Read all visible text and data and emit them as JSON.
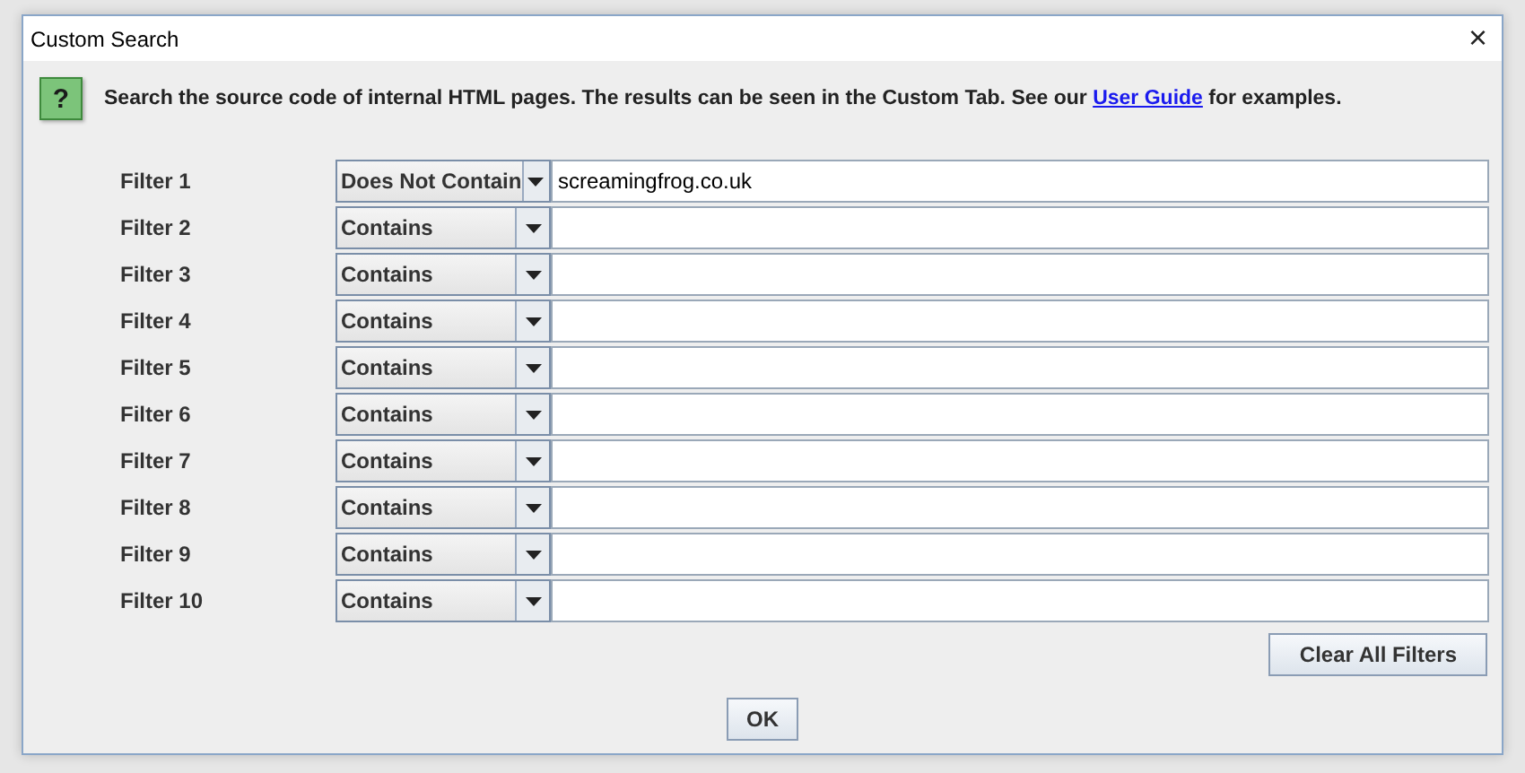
{
  "window": {
    "title": "Custom Search",
    "close": "×"
  },
  "help_icon": "?",
  "intro": {
    "text": "Search the source code of internal HTML pages. The results can be seen in the Custom Tab. See our ",
    "link": "User Guide",
    "text_after": " for examples."
  },
  "filters": [
    {
      "label": "Filter 1",
      "mode": "Does Not Contain",
      "value": "screamingfrog.co.uk"
    },
    {
      "label": "Filter 2",
      "mode": "Contains"
    },
    {
      "label": "Filter 3",
      "mode": "Contains"
    },
    {
      "label": "Filter 4",
      "mode": "Contains"
    },
    {
      "label": "Filter 5",
      "mode": "Contains"
    },
    {
      "label": "Filter 6",
      "mode": "Contains"
    },
    {
      "label": "Filter 7",
      "mode": "Contains"
    },
    {
      "label": "Filter 8",
      "mode": "Contains"
    },
    {
      "label": "Filter 9",
      "mode": "Contains"
    },
    {
      "label": "Filter 10",
      "mode": "Contains"
    }
  ],
  "clear_button": "Clear All Filters",
  "ok_button": "OK"
}
